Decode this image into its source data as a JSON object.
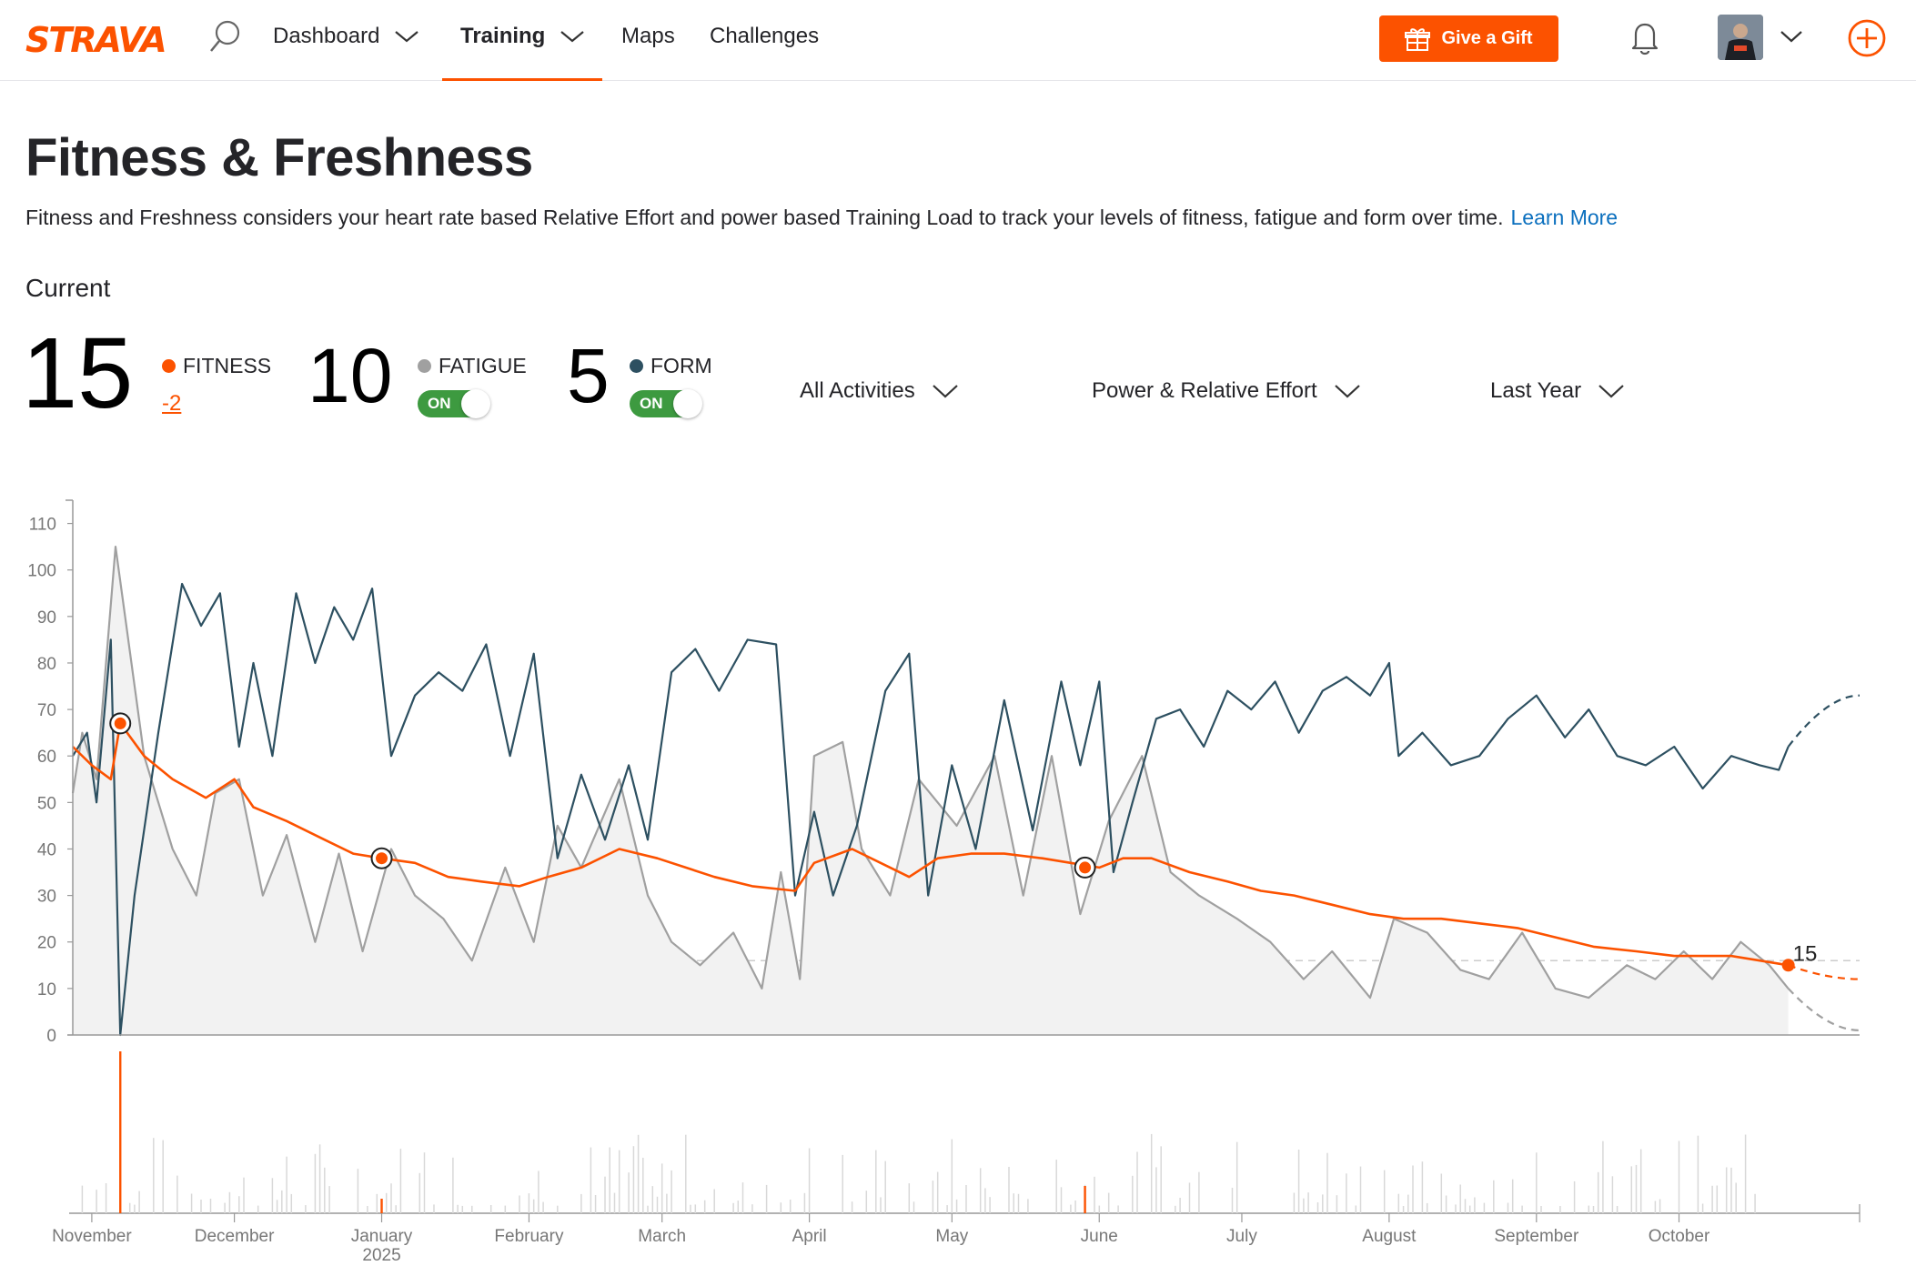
{
  "nav": {
    "logo": "STRAVA",
    "items": [
      {
        "label": "Dashboard"
      },
      {
        "label": "Training"
      },
      {
        "label": "Maps"
      },
      {
        "label": "Challenges"
      }
    ],
    "gift_label": "Give a Gift",
    "accent": "#fc5200"
  },
  "header": {
    "title": "Fitness & Freshness",
    "description": "Fitness and Freshness considers your heart rate based Relative Effort and power based Training Load to track your levels of fitness, fatigue and form over time.",
    "learn_more": "Learn More",
    "current_label": "Current"
  },
  "metrics": {
    "fitness": {
      "value": "15",
      "label": "FITNESS",
      "delta": "-2",
      "color": "#fc5200"
    },
    "fatigue": {
      "value": "10",
      "label": "FATIGUE",
      "toggle": "ON",
      "color": "#a0a0a0"
    },
    "form": {
      "value": "5",
      "label": "FORM",
      "toggle": "ON",
      "color": "#2d5061"
    }
  },
  "filters": {
    "activities": "All Activities",
    "metric": "Power & Relative Effort",
    "range": "Last Year"
  },
  "chart_data": {
    "type": "line",
    "title": "",
    "xlabel": "",
    "ylabel": "",
    "ylim": [
      0,
      115
    ],
    "y_ticks": [
      0,
      10,
      20,
      30,
      40,
      50,
      60,
      70,
      80,
      90,
      100,
      110
    ],
    "x_range": [
      "2024-10-28",
      "2025-11-08"
    ],
    "x_ticks": [
      {
        "date": "2024-11-01",
        "label": "November",
        "sub": ""
      },
      {
        "date": "2024-12-01",
        "label": "December",
        "sub": ""
      },
      {
        "date": "2025-01-01",
        "label": "January",
        "sub": "2025"
      },
      {
        "date": "2025-02-01",
        "label": "February",
        "sub": ""
      },
      {
        "date": "2025-03-01",
        "label": "March",
        "sub": ""
      },
      {
        "date": "2025-04-01",
        "label": "April",
        "sub": ""
      },
      {
        "date": "2025-05-01",
        "label": "May",
        "sub": ""
      },
      {
        "date": "2025-06-01",
        "label": "June",
        "sub": ""
      },
      {
        "date": "2025-07-01",
        "label": "July",
        "sub": ""
      },
      {
        "date": "2025-08-01",
        "label": "August",
        "sub": ""
      },
      {
        "date": "2025-09-01",
        "label": "September",
        "sub": ""
      },
      {
        "date": "2025-10-01",
        "label": "October",
        "sub": ""
      }
    ],
    "reference_value": 16,
    "end_label": "15",
    "series": [
      {
        "name": "FITNESS",
        "color": "#fc5200",
        "points": [
          [
            "2024-10-28",
            62
          ],
          [
            "2024-11-01",
            58
          ],
          [
            "2024-11-05",
            55
          ],
          [
            "2024-11-07",
            67
          ],
          [
            "2024-11-12",
            60
          ],
          [
            "2024-11-18",
            55
          ],
          [
            "2024-11-25",
            51
          ],
          [
            "2024-12-01",
            55
          ],
          [
            "2024-12-05",
            49
          ],
          [
            "2024-12-12",
            46
          ],
          [
            "2024-12-20",
            42
          ],
          [
            "2024-12-26",
            39
          ],
          [
            "2025-01-01",
            38
          ],
          [
            "2025-01-08",
            37
          ],
          [
            "2025-01-15",
            34
          ],
          [
            "2025-01-22",
            33
          ],
          [
            "2025-01-30",
            32
          ],
          [
            "2025-02-05",
            34
          ],
          [
            "2025-02-12",
            36
          ],
          [
            "2025-02-20",
            40
          ],
          [
            "2025-02-28",
            38
          ],
          [
            "2025-03-06",
            36
          ],
          [
            "2025-03-12",
            34
          ],
          [
            "2025-03-20",
            32
          ],
          [
            "2025-03-29",
            31
          ],
          [
            "2025-04-02",
            37
          ],
          [
            "2025-04-10",
            40
          ],
          [
            "2025-04-18",
            36
          ],
          [
            "2025-04-22",
            34
          ],
          [
            "2025-04-28",
            38
          ],
          [
            "2025-05-05",
            39
          ],
          [
            "2025-05-12",
            39
          ],
          [
            "2025-05-20",
            38
          ],
          [
            "2025-05-26",
            37
          ],
          [
            "2025-06-01",
            36
          ],
          [
            "2025-06-06",
            38
          ],
          [
            "2025-06-12",
            38
          ],
          [
            "2025-06-20",
            35
          ],
          [
            "2025-06-28",
            33
          ],
          [
            "2025-07-05",
            31
          ],
          [
            "2025-07-12",
            30
          ],
          [
            "2025-07-20",
            28
          ],
          [
            "2025-07-28",
            26
          ],
          [
            "2025-08-04",
            25
          ],
          [
            "2025-08-12",
            25
          ],
          [
            "2025-08-20",
            24
          ],
          [
            "2025-08-28",
            23
          ],
          [
            "2025-09-05",
            21
          ],
          [
            "2025-09-13",
            19
          ],
          [
            "2025-09-22",
            18
          ],
          [
            "2025-09-30",
            17
          ],
          [
            "2025-10-06",
            17
          ],
          [
            "2025-10-12",
            17
          ],
          [
            "2025-10-18",
            16
          ],
          [
            "2025-10-24",
            15
          ]
        ]
      },
      {
        "name": "FATIGUE",
        "color": "#a0a0a0",
        "points": [
          [
            "2024-10-28",
            52
          ],
          [
            "2024-10-30",
            65
          ],
          [
            "2024-11-02",
            55
          ],
          [
            "2024-11-06",
            105
          ],
          [
            "2024-11-08",
            90
          ],
          [
            "2024-11-12",
            60
          ],
          [
            "2024-11-18",
            40
          ],
          [
            "2024-11-23",
            30
          ],
          [
            "2024-11-27",
            52
          ],
          [
            "2024-12-02",
            55
          ],
          [
            "2024-12-07",
            30
          ],
          [
            "2024-12-12",
            43
          ],
          [
            "2024-12-18",
            20
          ],
          [
            "2024-12-23",
            39
          ],
          [
            "2024-12-28",
            18
          ],
          [
            "2025-01-03",
            40
          ],
          [
            "2025-01-08",
            30
          ],
          [
            "2025-01-14",
            25
          ],
          [
            "2025-01-20",
            16
          ],
          [
            "2025-01-27",
            36
          ],
          [
            "2025-02-02",
            20
          ],
          [
            "2025-02-07",
            45
          ],
          [
            "2025-02-12",
            36
          ],
          [
            "2025-02-20",
            55
          ],
          [
            "2025-02-26",
            30
          ],
          [
            "2025-03-03",
            20
          ],
          [
            "2025-03-09",
            15
          ],
          [
            "2025-03-16",
            22
          ],
          [
            "2025-03-22",
            10
          ],
          [
            "2025-03-26",
            35
          ],
          [
            "2025-03-30",
            12
          ],
          [
            "2025-04-02",
            60
          ],
          [
            "2025-04-08",
            63
          ],
          [
            "2025-04-12",
            40
          ],
          [
            "2025-04-18",
            30
          ],
          [
            "2025-04-24",
            55
          ],
          [
            "2025-05-02",
            45
          ],
          [
            "2025-05-10",
            60
          ],
          [
            "2025-05-16",
            30
          ],
          [
            "2025-05-22",
            60
          ],
          [
            "2025-05-28",
            26
          ],
          [
            "2025-06-03",
            46
          ],
          [
            "2025-06-10",
            60
          ],
          [
            "2025-06-16",
            35
          ],
          [
            "2025-06-22",
            30
          ],
          [
            "2025-06-30",
            25
          ],
          [
            "2025-07-07",
            20
          ],
          [
            "2025-07-14",
            12
          ],
          [
            "2025-07-20",
            18
          ],
          [
            "2025-07-28",
            8
          ],
          [
            "2025-08-02",
            25
          ],
          [
            "2025-08-09",
            22
          ],
          [
            "2025-08-16",
            14
          ],
          [
            "2025-08-22",
            12
          ],
          [
            "2025-08-29",
            22
          ],
          [
            "2025-09-05",
            10
          ],
          [
            "2025-09-12",
            8
          ],
          [
            "2025-09-20",
            15
          ],
          [
            "2025-09-26",
            12
          ],
          [
            "2025-10-02",
            18
          ],
          [
            "2025-10-08",
            12
          ],
          [
            "2025-10-14",
            20
          ],
          [
            "2025-10-20",
            15
          ],
          [
            "2025-10-24",
            10
          ]
        ]
      },
      {
        "name": "FORM",
        "color": "#2d5061",
        "points": [
          [
            "2024-10-28",
            60
          ],
          [
            "2024-10-31",
            65
          ],
          [
            "2024-11-02",
            50
          ],
          [
            "2024-11-05",
            85
          ],
          [
            "2024-11-07",
            0
          ],
          [
            "2024-11-10",
            30
          ],
          [
            "2024-11-15",
            65
          ],
          [
            "2024-11-20",
            97
          ],
          [
            "2024-11-24",
            88
          ],
          [
            "2024-11-28",
            95
          ],
          [
            "2024-12-02",
            62
          ],
          [
            "2024-12-05",
            80
          ],
          [
            "2024-12-09",
            60
          ],
          [
            "2024-12-14",
            95
          ],
          [
            "2024-12-18",
            80
          ],
          [
            "2024-12-22",
            92
          ],
          [
            "2024-12-26",
            85
          ],
          [
            "2024-12-30",
            96
          ],
          [
            "2025-01-03",
            60
          ],
          [
            "2025-01-08",
            73
          ],
          [
            "2025-01-13",
            78
          ],
          [
            "2025-01-18",
            74
          ],
          [
            "2025-01-23",
            84
          ],
          [
            "2025-01-28",
            60
          ],
          [
            "2025-02-02",
            82
          ],
          [
            "2025-02-07",
            38
          ],
          [
            "2025-02-12",
            56
          ],
          [
            "2025-02-17",
            42
          ],
          [
            "2025-02-22",
            58
          ],
          [
            "2025-02-26",
            42
          ],
          [
            "2025-03-03",
            78
          ],
          [
            "2025-03-08",
            83
          ],
          [
            "2025-03-13",
            74
          ],
          [
            "2025-03-19",
            85
          ],
          [
            "2025-03-25",
            84
          ],
          [
            "2025-03-29",
            30
          ],
          [
            "2025-04-02",
            48
          ],
          [
            "2025-04-06",
            30
          ],
          [
            "2025-04-11",
            45
          ],
          [
            "2025-04-17",
            74
          ],
          [
            "2025-04-22",
            82
          ],
          [
            "2025-04-26",
            30
          ],
          [
            "2025-05-01",
            58
          ],
          [
            "2025-05-06",
            40
          ],
          [
            "2025-05-12",
            72
          ],
          [
            "2025-05-18",
            44
          ],
          [
            "2025-05-24",
            76
          ],
          [
            "2025-05-28",
            58
          ],
          [
            "2025-06-01",
            76
          ],
          [
            "2025-06-04",
            35
          ],
          [
            "2025-06-08",
            50
          ],
          [
            "2025-06-13",
            68
          ],
          [
            "2025-06-18",
            70
          ],
          [
            "2025-06-23",
            62
          ],
          [
            "2025-06-28",
            74
          ],
          [
            "2025-07-03",
            70
          ],
          [
            "2025-07-08",
            76
          ],
          [
            "2025-07-13",
            65
          ],
          [
            "2025-07-18",
            74
          ],
          [
            "2025-07-23",
            77
          ],
          [
            "2025-07-28",
            73
          ],
          [
            "2025-08-01",
            80
          ],
          [
            "2025-08-03",
            60
          ],
          [
            "2025-08-08",
            65
          ],
          [
            "2025-08-14",
            58
          ],
          [
            "2025-08-20",
            60
          ],
          [
            "2025-08-26",
            68
          ],
          [
            "2025-09-01",
            73
          ],
          [
            "2025-09-07",
            64
          ],
          [
            "2025-09-12",
            70
          ],
          [
            "2025-09-18",
            60
          ],
          [
            "2025-09-24",
            58
          ],
          [
            "2025-09-30",
            62
          ],
          [
            "2025-10-06",
            53
          ],
          [
            "2025-10-12",
            60
          ],
          [
            "2025-10-18",
            58
          ],
          [
            "2025-10-22",
            57
          ],
          [
            "2025-10-24",
            62
          ]
        ]
      }
    ],
    "projections": [
      {
        "name": "FITNESS",
        "points": [
          [
            "2025-10-24",
            15
          ],
          [
            "2025-11-08",
            12
          ]
        ]
      },
      {
        "name": "FATIGUE",
        "points": [
          [
            "2025-10-24",
            10
          ],
          [
            "2025-11-08",
            1
          ]
        ]
      },
      {
        "name": "FORM",
        "points": [
          [
            "2025-10-24",
            62
          ],
          [
            "2025-11-08",
            73
          ]
        ]
      }
    ],
    "markers": [
      {
        "date": "2024-11-07",
        "value": 67
      },
      {
        "date": "2025-01-01",
        "value": 38
      },
      {
        "date": "2025-05-29",
        "value": 36
      },
      {
        "date": "2025-10-24",
        "value": 15
      }
    ],
    "daily_effort": {
      "note": "relative activity bars below main chart",
      "highlight_dates": [
        "2024-11-07",
        "2025-01-01",
        "2025-05-29"
      ]
    }
  }
}
